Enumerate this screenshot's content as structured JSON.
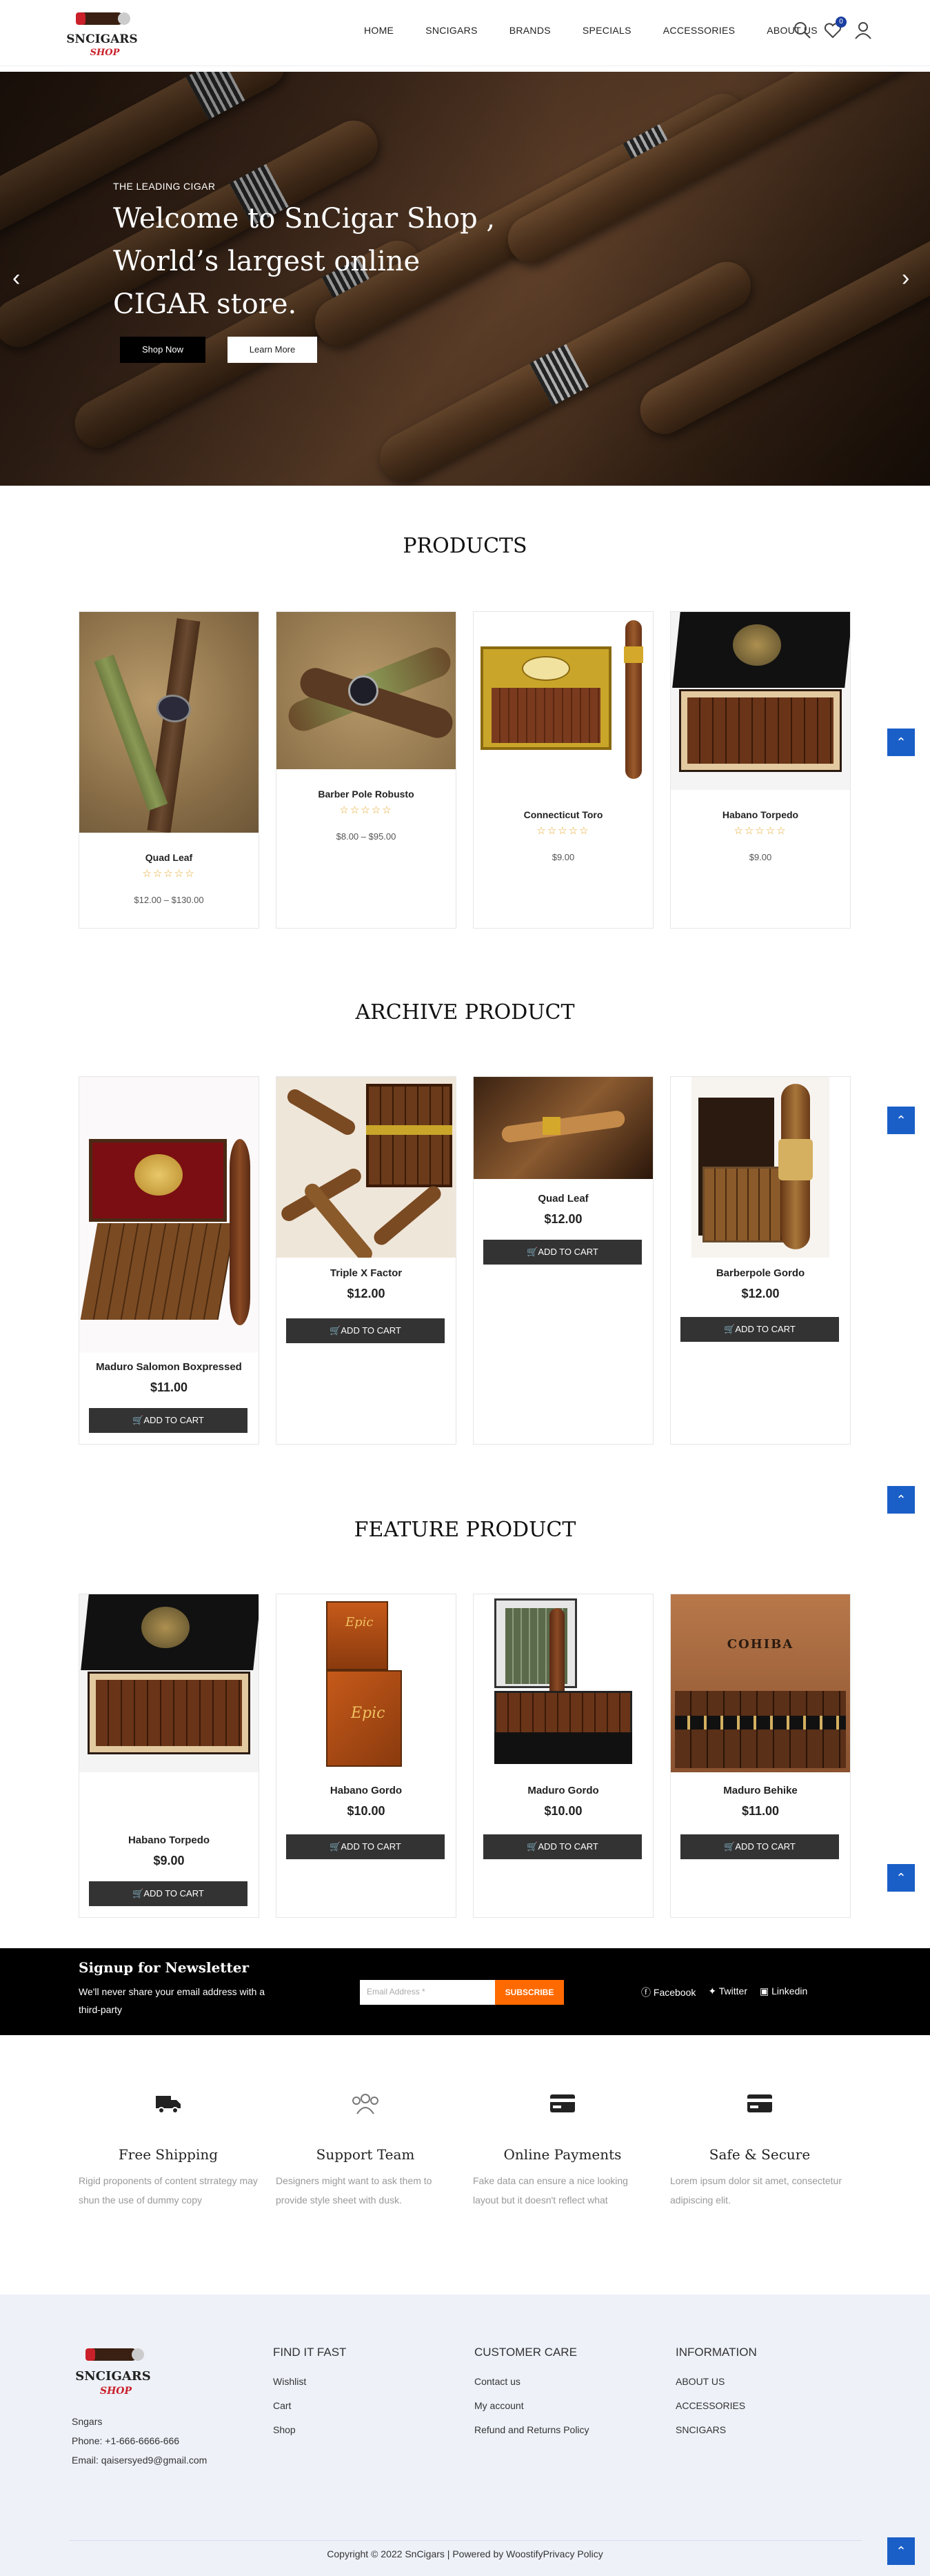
{
  "header": {
    "logo_text": "SNCIGARS",
    "logo_sub": "SHOP",
    "nav": [
      "HOME",
      "SNCIGARS",
      "BRANDS",
      "SPECIALS",
      "ACCESSORIES",
      "ABOUT US"
    ],
    "wishlist_count": "0"
  },
  "hero": {
    "subtitle": "THE LEADING CIGAR",
    "title_lines": [
      "Welcome to SnCigar Shop ,",
      "World’s largest online",
      "CIGAR store."
    ],
    "shop_now": "Shop Now",
    "learn_more": "Learn More"
  },
  "products": {
    "title": "PRODUCTS",
    "items": [
      {
        "name": "Quad Leaf",
        "price": "$12.00 – $130.00"
      },
      {
        "name": "Barber Pole Robusto",
        "price": "$8.00 – $95.00"
      },
      {
        "name": "Connecticut Toro",
        "price": "$9.00"
      },
      {
        "name": "Habano Torpedo",
        "price": "$9.00"
      }
    ],
    "stars": "☆☆☆☆☆"
  },
  "archive": {
    "title": "ARCHIVE PRODUCT",
    "items": [
      {
        "name": "Maduro Salomon Boxpressed",
        "price": "$11.00"
      },
      {
        "name": "Triple X Factor",
        "price": "$12.00"
      },
      {
        "name": "Quad Leaf",
        "price": "$12.00"
      },
      {
        "name": "Barberpole Gordo",
        "price": "$12.00"
      }
    ]
  },
  "feature": {
    "title": "FEATURE PRODUCT",
    "items": [
      {
        "name": "Habano Torpedo",
        "price": "$9.00"
      },
      {
        "name": "Habano Gordo",
        "price": "$10.00"
      },
      {
        "name": "Maduro Gordo",
        "price": "$10.00"
      },
      {
        "name": "Maduro Behike",
        "price": "$11.00"
      }
    ],
    "box_label_2": "Epic",
    "box_label_4": "COHIBA"
  },
  "cart_label": "🛒ADD TO CART",
  "newsletter": {
    "title": "Signup for Newsletter",
    "text": "We'll never share your email address with a third-party",
    "placeholder": "Email Address *",
    "subscribe": "SUBSCRIBE",
    "social": [
      "Facebook",
      "Twitter",
      "Linkedin"
    ]
  },
  "features": [
    {
      "title": "Free Shipping",
      "text": "Rigid  proponents of content strrategy may shun the use of dummy copy",
      "icon": "truck-icon"
    },
    {
      "title": "Support Team",
      "text": "Designers might want to ask them to provide style sheet with dusk.",
      "icon": "team-icon"
    },
    {
      "title": "Online Payments",
      "text": "Fake data can ensure a nice looking layout but it doesn't reflect what",
      "icon": "card-icon"
    },
    {
      "title": "Safe & Secure",
      "text": "Lorem ipsum dolor sit amet, consectetur adipiscing elit.",
      "icon": "card-icon"
    }
  ],
  "footer": {
    "brand": "Sngars",
    "phone": "Phone: +1-666-6666-666",
    "email": "Email: qaisersyed9@gmail.com",
    "col1": {
      "title": "FIND IT FAST",
      "links": [
        "Wishlist",
        "Cart",
        "Shop"
      ]
    },
    "col2": {
      "title": "CUSTOMER CARE",
      "links": [
        "Contact us",
        "My account",
        "Refund and Returns Policy"
      ]
    },
    "col3": {
      "title": "INFORMATION",
      "links": [
        "ABOUT US",
        "ACCESSORIES",
        "SNCIGARS"
      ]
    },
    "copyright": "Copyright © 2022 SnCigars | Powered by WoostifyPrivacy Policy"
  },
  "colors": {
    "accent": "#1a5fc7",
    "subscribe": "#ff6a00",
    "cart": "#333333",
    "star": "#e7a92c"
  }
}
